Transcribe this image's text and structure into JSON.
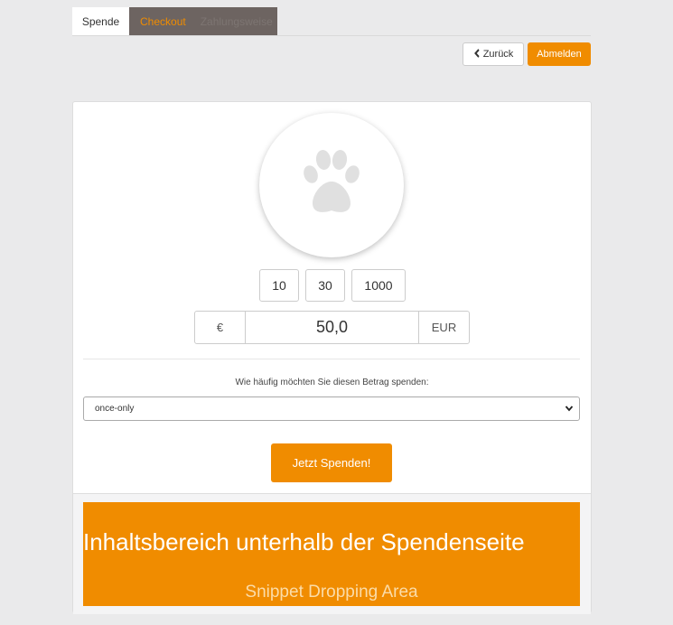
{
  "tabs": {
    "spende": "Spende",
    "checkout": "Checkout",
    "zahlung": "Zahlungsweise"
  },
  "topbar": {
    "back_label": "Zurück",
    "logout_label": "Abmelden"
  },
  "colors": {
    "accent": "#f08c00",
    "background": "#eaeaeb"
  },
  "donation": {
    "avatar_icon": "paw-icon",
    "preset_amounts": [
      "10",
      "30",
      "1000"
    ],
    "currency_symbol": "€",
    "amount_value": "50,0",
    "currency_code": "EUR",
    "frequency_label": "Wie häufig möchten Sie diesen Betrag spenden:",
    "frequency_selected": "once-only",
    "submit_label": "Jetzt Spenden!"
  },
  "snippet": {
    "title": "Inhaltsbereich unterhalb der Spendenseite",
    "subtitle": "Snippet Dropping Area"
  }
}
